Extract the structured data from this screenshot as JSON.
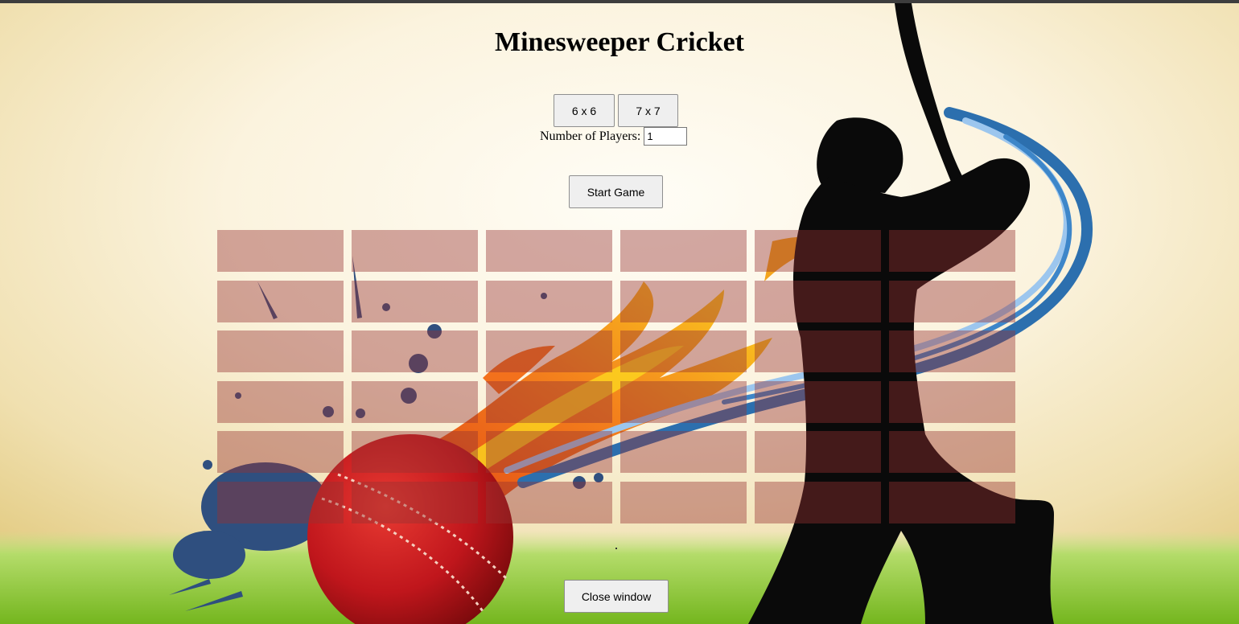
{
  "title": "Minesweeper Cricket",
  "controls": {
    "size_options": [
      "6 x 6",
      "7 x 7"
    ],
    "players_label": "Number of Players:",
    "players_value": "1",
    "start_label": "Start Game"
  },
  "board": {
    "rows": 6,
    "cols": 6,
    "cell_color": "#963232"
  },
  "footer": {
    "close_label": "Close window"
  },
  "colors": {
    "sky_light": "#fffdf6",
    "sky_warm": "#ead797",
    "grass": "#8ecb33",
    "silhouette": "#0a0a0a",
    "ball_red": "#c0161c",
    "flame_orange": "#f36b12",
    "flame_yellow": "#fbd115",
    "splash_blue": "#2f4f7f",
    "swoosh_blue": "#2c6fae"
  }
}
